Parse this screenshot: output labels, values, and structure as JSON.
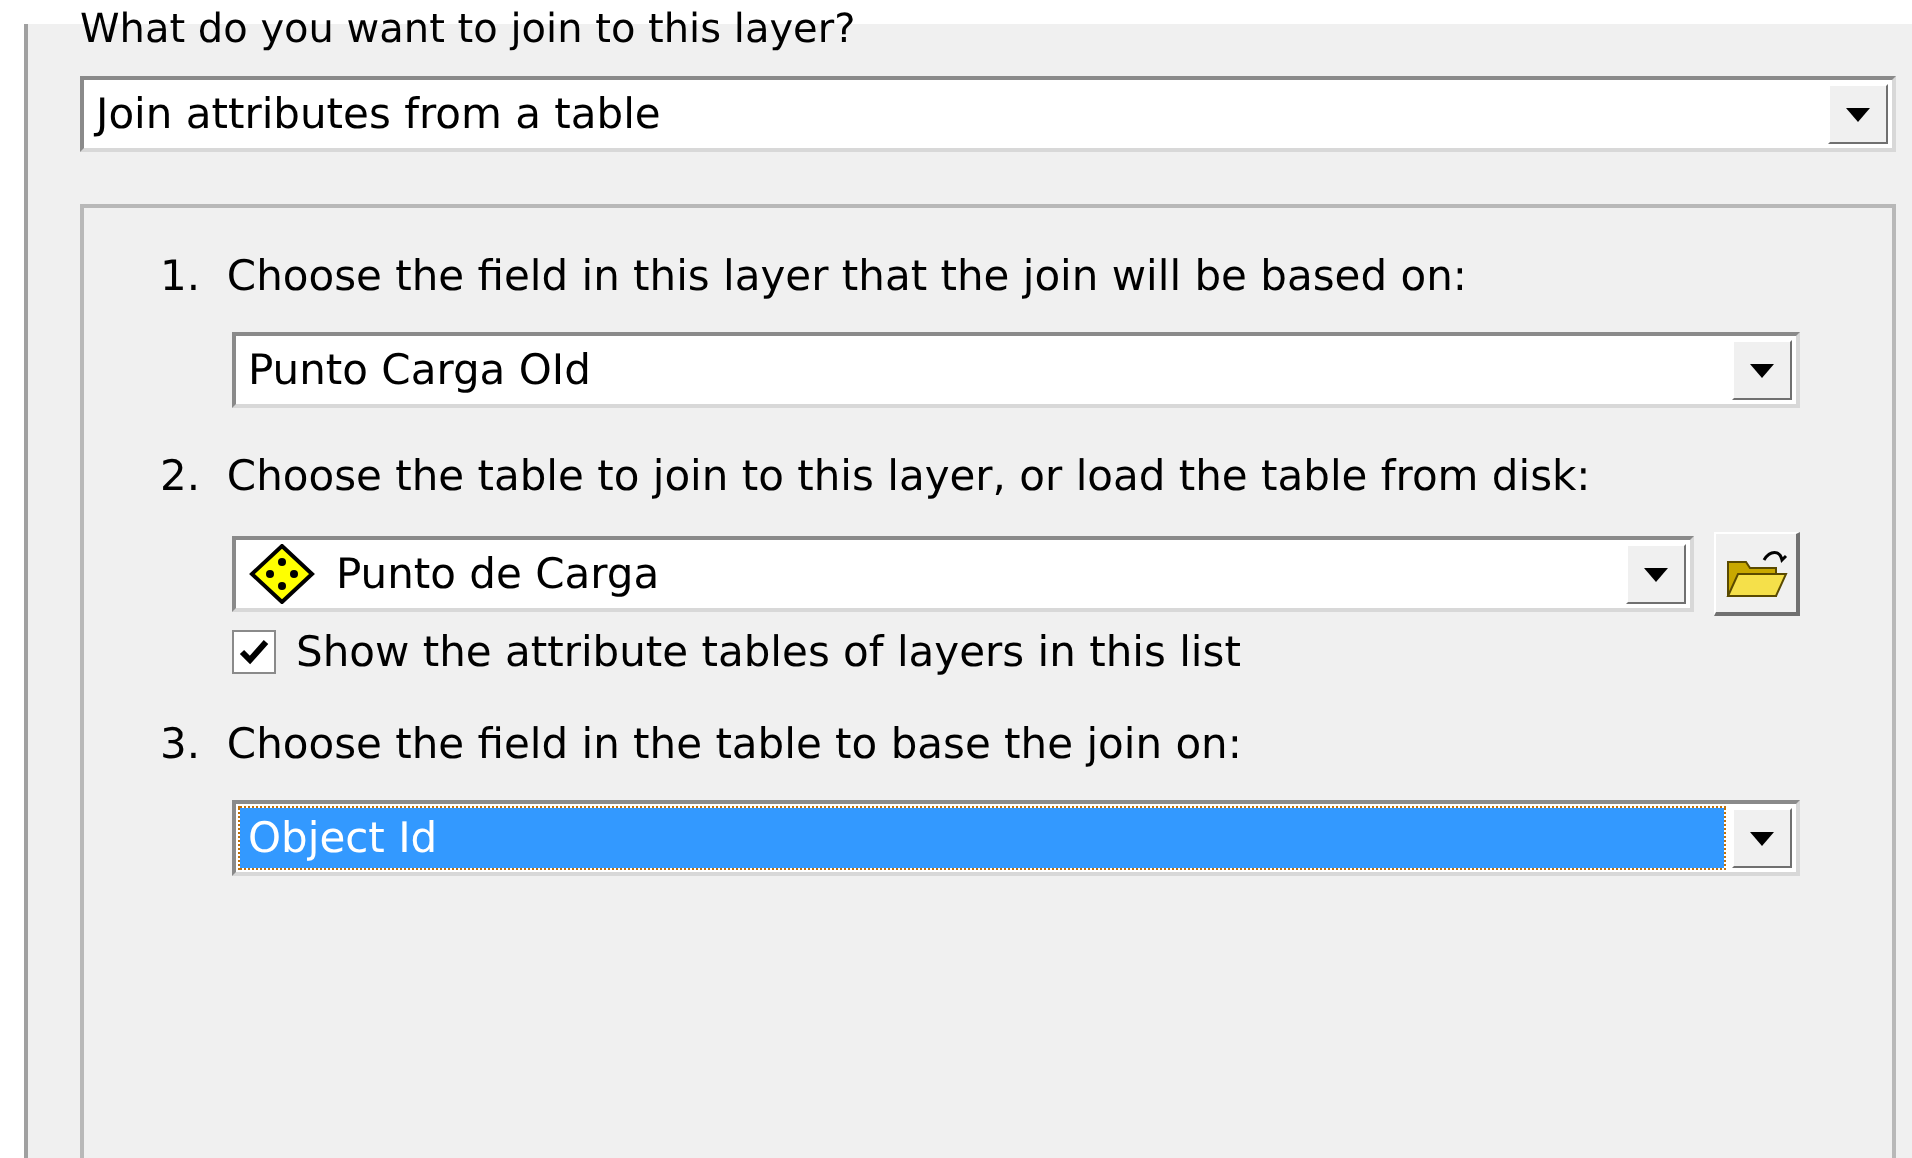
{
  "question": "What do you want to join to this layer?",
  "join_type": {
    "value": "Join attributes from a table",
    "focused": false
  },
  "steps": [
    {
      "number": "1.",
      "label": "Choose the field in this layer that the join will be based on:",
      "dropdown": {
        "value": "Punto Carga OId",
        "focused": false
      }
    },
    {
      "number": "2.",
      "label": "Choose the table to join to this layer, or load the table from disk:",
      "dropdown": {
        "value": "Punto de Carga",
        "focused": false,
        "layer_icon": true
      },
      "browse_button": true,
      "checkbox": {
        "label": "Show the attribute tables of layers in this list",
        "checked": true
      }
    },
    {
      "number": "3.",
      "label": "Choose the field in the table to base the join on:",
      "dropdown": {
        "value": "Object Id",
        "focused": true
      }
    }
  ]
}
